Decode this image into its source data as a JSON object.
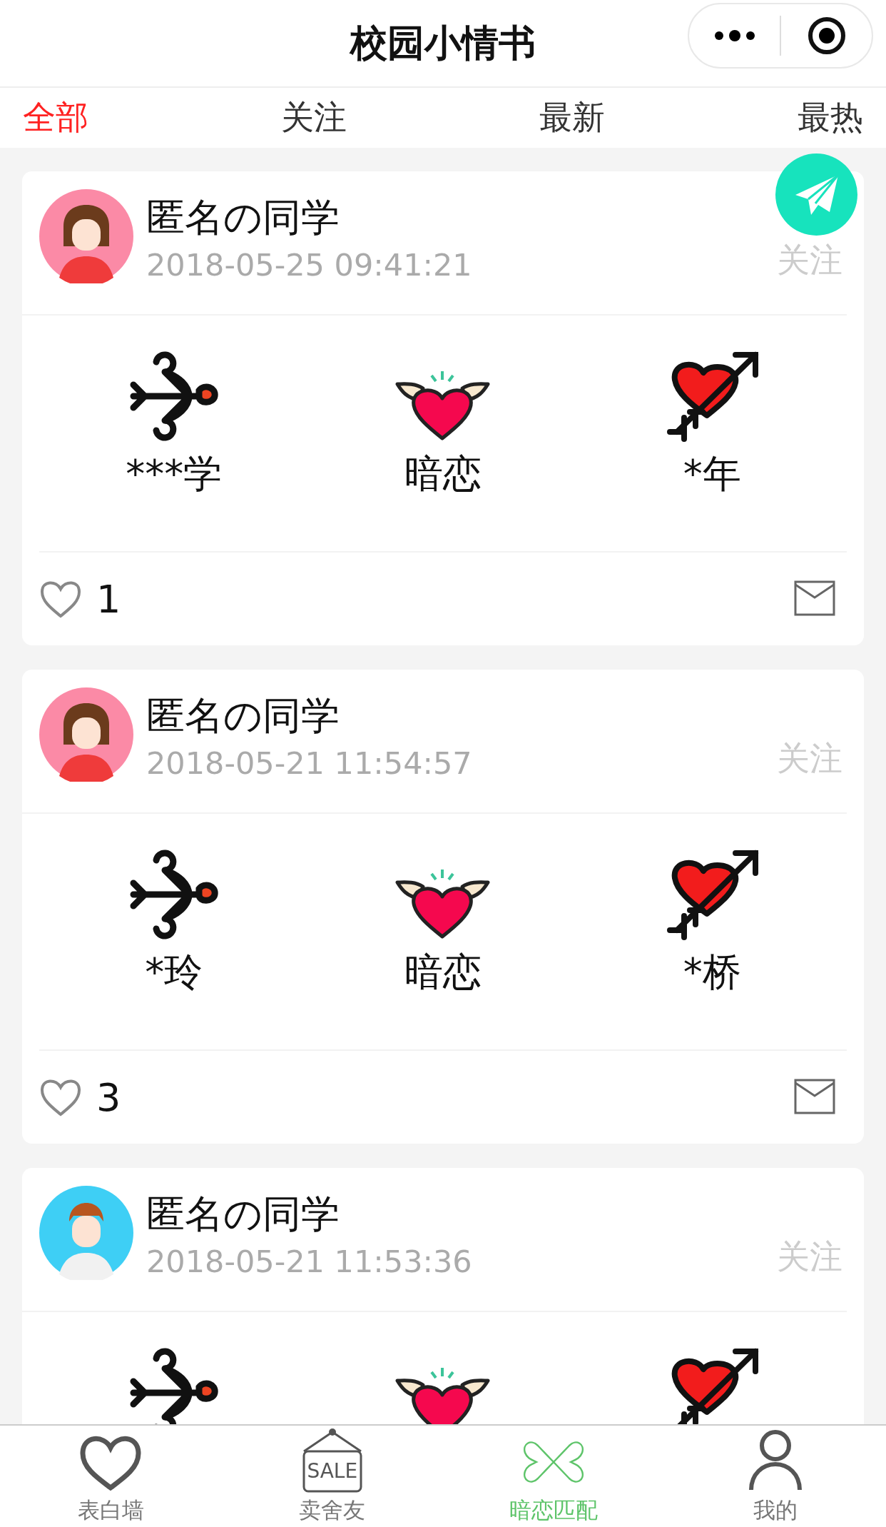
{
  "header": {
    "title": "校园小情书"
  },
  "tabs": [
    {
      "label": "全部",
      "selected": true
    },
    {
      "label": "关注",
      "selected": false
    },
    {
      "label": "最新",
      "selected": false
    },
    {
      "label": "最热",
      "selected": false
    }
  ],
  "posts": [
    {
      "avatar": {
        "kind": "girl"
      },
      "author": "匿名の同学",
      "time": "2018-05-25 09:41:21",
      "follow": "关注",
      "from": "***学",
      "relation": "暗恋",
      "to": "*年",
      "likes": "1"
    },
    {
      "avatar": {
        "kind": "girl"
      },
      "author": "匿名の同学",
      "time": "2018-05-21 11:54:57",
      "follow": "关注",
      "from": "*玲",
      "relation": "暗恋",
      "to": "*桥",
      "likes": "3"
    },
    {
      "avatar": {
        "kind": "boy"
      },
      "author": "匿名の同学",
      "time": "2018-05-21 11:53:36",
      "follow": "关注"
    }
  ],
  "nav": [
    {
      "kind": "heart",
      "label": "表白墙",
      "selected": false
    },
    {
      "kind": "sale",
      "label": "卖舍友",
      "sign": "SALE",
      "selected": false
    },
    {
      "kind": "match",
      "label": "暗恋匹配",
      "selected": true
    },
    {
      "kind": "user",
      "label": "我的",
      "selected": false
    }
  ]
}
